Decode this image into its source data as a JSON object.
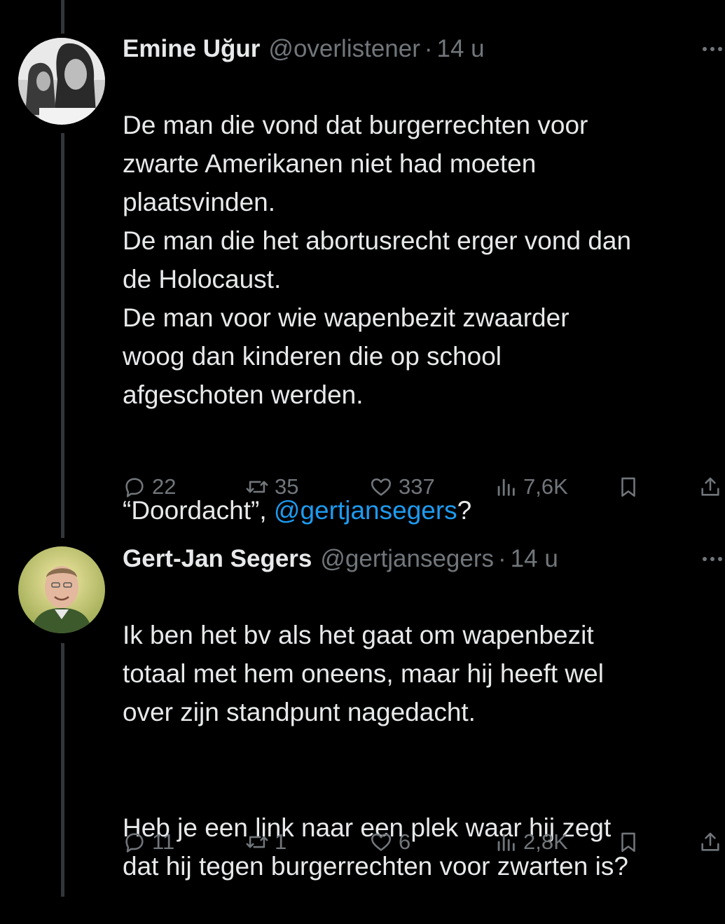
{
  "tweets": [
    {
      "name": "Emine Uğur",
      "handle": "@overlistener",
      "separator": "·",
      "time": "14 u",
      "text": "De man die vond dat burgerrechten voor\nzwarte Amerikanen niet had moeten\nplaatsvinden.\nDe man die het abortusrecht erger vond dan\nde Holocaust.\nDe man voor wie wapenbezit zwaarder\nwoog dan kinderen die op school\nafgeschoten werden.",
      "quote_before": "“Doordacht”, ",
      "mention": "@gertjansegers",
      "quote_after": "?",
      "stats": {
        "replies": "22",
        "reposts": "35",
        "likes": "337",
        "views": "7,6K"
      }
    },
    {
      "name": "Gert-Jan Segers",
      "handle": "@gertjansegers",
      "separator": "·",
      "time": "14 u",
      "text": "Ik ben het bv als het gaat om wapenbezit\ntotaal met hem oneens, maar hij heeft wel\nover zijn standpunt nagedacht.",
      "text2": "Heb je een link naar een plek waar hij zegt\ndat hij tegen burgerrechten voor zwarten is?",
      "stats": {
        "replies": "11",
        "reposts": "1",
        "likes": "6",
        "views": "2,8K"
      }
    }
  ],
  "icons": [
    "reply-icon",
    "repost-icon",
    "like-icon",
    "views-icon",
    "bookmark-icon",
    "share-icon",
    "more-icon"
  ],
  "colors": {
    "background": "#000000",
    "text": "#e7e9ea",
    "muted": "#71767b",
    "link": "#1d9bf0"
  }
}
